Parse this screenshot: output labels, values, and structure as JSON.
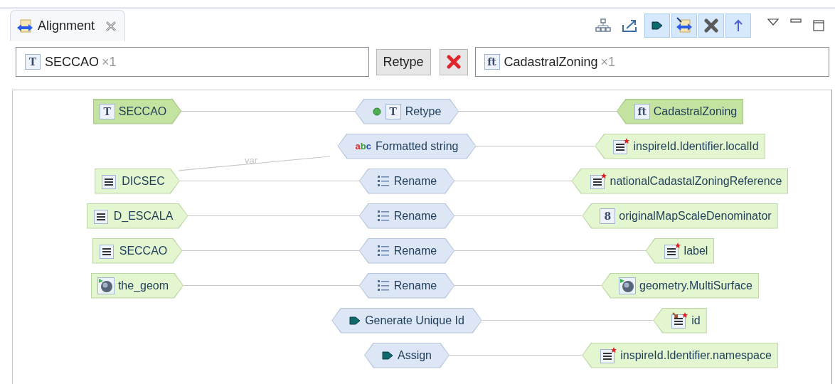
{
  "tab": {
    "title": "Alignment",
    "selected": true
  },
  "toolbar": [
    {
      "kind": "hierarchy",
      "selected": false
    },
    {
      "kind": "export",
      "selected": false
    },
    {
      "kind": "arrow",
      "selected": true
    },
    {
      "kind": "alignment",
      "selected": true
    },
    {
      "kind": "delete",
      "selected": true
    },
    {
      "kind": "up",
      "selected": true
    }
  ],
  "filter": {
    "source": {
      "glyph": "T",
      "name": "SECCAO",
      "count": "×1"
    },
    "function_button": "Retype",
    "target": {
      "glyph": "ft",
      "name": "CadastralZoning",
      "count": "×1"
    }
  },
  "rows": [
    {
      "source": {
        "kind": "letter",
        "highlighted": true,
        "glyph": "T",
        "label": "SECCAO"
      },
      "function": {
        "label": "Retype",
        "icons": [
          {
            "kind": "dot"
          },
          {
            "kind": "letter",
            "glyph": "T"
          }
        ]
      },
      "target": {
        "kind": "letter",
        "highlighted": true,
        "glyph": "ft",
        "label": "CadastralZoning"
      }
    },
    {
      "input_label": "var",
      "function": {
        "label": "Formatted string",
        "icons": [
          {
            "kind": "abc",
            "glyph": "abc"
          }
        ]
      },
      "target": {
        "kind": "lines-required",
        "highlighted": false,
        "label": "inspireId.Identifier.localId"
      }
    },
    {
      "source": {
        "kind": "lines",
        "highlighted": false,
        "label": "DICSEC"
      },
      "function": {
        "label": "Rename",
        "icons": [
          {
            "kind": "list"
          }
        ]
      },
      "target": {
        "kind": "lines-required",
        "highlighted": false,
        "label": "nationalCadastalZoningReference"
      }
    },
    {
      "source": {
        "kind": "lines",
        "highlighted": false,
        "label": "D_ESCALA"
      },
      "function": {
        "label": "Rename",
        "icons": [
          {
            "kind": "list"
          }
        ]
      },
      "target": {
        "kind": "letter",
        "highlighted": false,
        "glyph": "8",
        "label": "originalMapScaleDenominator"
      }
    },
    {
      "source": {
        "kind": "lines",
        "highlighted": false,
        "label": "SECCAO"
      },
      "function": {
        "label": "Rename",
        "icons": [
          {
            "kind": "list"
          }
        ]
      },
      "target": {
        "kind": "lines-required",
        "highlighted": false,
        "label": "label"
      }
    },
    {
      "source": {
        "kind": "geometry",
        "highlighted": false,
        "label": "the_geom"
      },
      "function": {
        "label": "Rename",
        "icons": [
          {
            "kind": "list"
          }
        ]
      },
      "target": {
        "kind": "geometry",
        "highlighted": false,
        "label": "geometry.MultiSurface"
      }
    },
    {
      "function": {
        "label": "Generate Unique Id",
        "icons": [
          {
            "kind": "arrow"
          }
        ]
      },
      "target": {
        "kind": "lines-linked",
        "highlighted": false,
        "label": "id"
      }
    },
    {
      "function": {
        "label": "Assign",
        "icons": [
          {
            "kind": "arrow"
          }
        ]
      },
      "target": {
        "kind": "lines-required",
        "highlighted": false,
        "label": "inspireId.Identifier.namespace"
      }
    }
  ]
}
